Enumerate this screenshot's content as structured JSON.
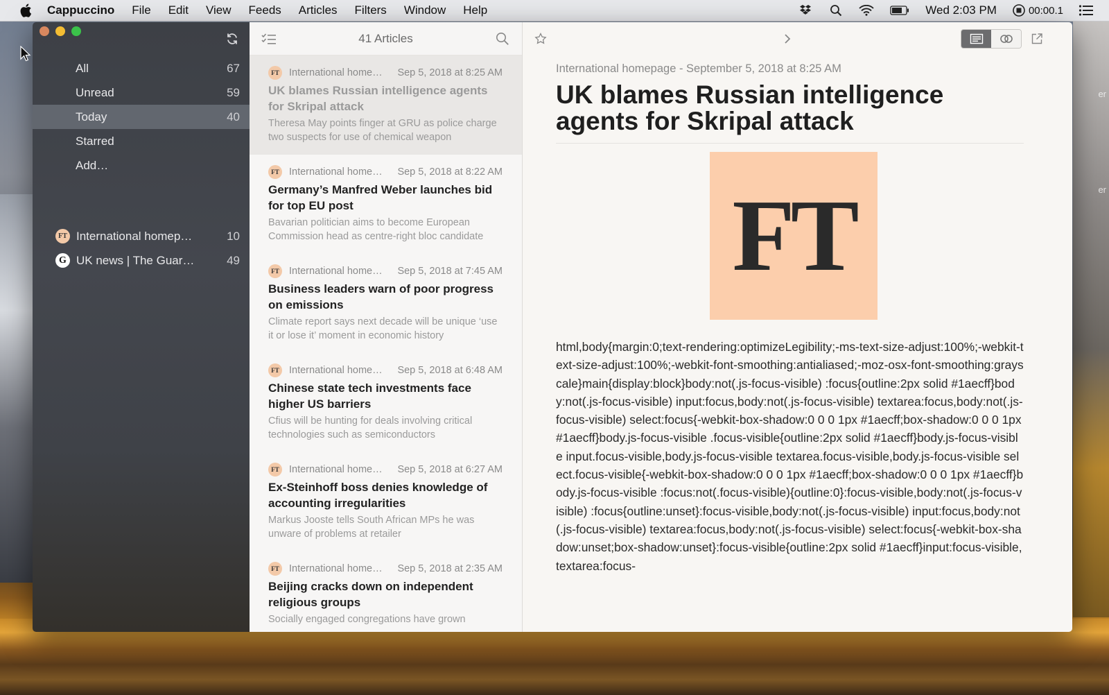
{
  "menubar": {
    "app_name": "Cappuccino",
    "menus": [
      "File",
      "Edit",
      "View",
      "Feeds",
      "Articles",
      "Filters",
      "Window",
      "Help"
    ],
    "clock": "Wed 2:03 PM",
    "timer": "00:00.1"
  },
  "desktop": {
    "label_top": "er",
    "label_bottom": "er"
  },
  "sidebar": {
    "smart_items": [
      {
        "label": "All",
        "count": "67"
      },
      {
        "label": "Unread",
        "count": "59"
      },
      {
        "label": "Today",
        "count": "40"
      },
      {
        "label": "Starred",
        "count": ""
      },
      {
        "label": "Add…",
        "count": ""
      }
    ],
    "feeds": [
      {
        "label": "International homep…",
        "count": "10",
        "favicon": "FT"
      },
      {
        "label": "UK news | The Guar…",
        "count": "49",
        "favicon": "G"
      }
    ]
  },
  "article_list": {
    "title": "41 Articles",
    "articles": [
      {
        "feed": "International home…",
        "date": "Sep 5, 2018 at 8:25 AM",
        "headline": "UK blames Russian intelligence agents for Skripal attack",
        "summary": "Theresa May points finger at GRU as police charge two suspects for use of chemical weapon"
      },
      {
        "feed": "International home…",
        "date": "Sep 5, 2018 at 8:22 AM",
        "headline": "Germany’s Manfred Weber launches bid for top EU post",
        "summary": "Bavarian politician aims to become European Commission head as centre-right bloc candidate"
      },
      {
        "feed": "International home…",
        "date": "Sep 5, 2018 at 7:45 AM",
        "headline": "Business leaders warn of poor progress on emissions",
        "summary": "Climate report says next decade will be unique ‘use it or lose it’ moment in economic history"
      },
      {
        "feed": "International home…",
        "date": "Sep 5, 2018 at 6:48 AM",
        "headline": "Chinese state tech investments face higher US barriers",
        "summary": "Cfius will be hunting for deals involving critical technologies such as semiconductors"
      },
      {
        "feed": "International home…",
        "date": "Sep 5, 2018 at 6:27 AM",
        "headline": "Ex-Steinhoff boss denies knowledge of accounting irregularities",
        "summary": "Markus Jooste tells South African MPs he was unware of problems at retailer"
      },
      {
        "feed": "International home…",
        "date": "Sep 5, 2018 at 2:35 AM",
        "headline": "Beijing cracks down on independent religious groups",
        "summary": "Socially engaged congregations have grown"
      }
    ],
    "favicon_text": "FT"
  },
  "reader": {
    "meta": "International homepage - September 5, 2018 at 8:25 AM",
    "title": "UK blames Russian intelligence agents for Skripal attack",
    "image_text": "FT",
    "body": "html,body{margin:0;text-rendering:optimizeLegibility;-ms-text-size-adjust:100%;-webkit-text-size-adjust:100%;-webkit-font-smoothing:antialiased;-moz-osx-font-smoothing:grayscale}main{display:block}body:not(.js-focus-visible) :focus{outline:2px solid #1aecff}body:not(.js-focus-visible) input:focus,body:not(.js-focus-visible) textarea:focus,body:not(.js-focus-visible) select:focus{-webkit-box-shadow:0 0 0 1px #1aecff;box-shadow:0 0 0 1px #1aecff}body.js-focus-visible .focus-visible{outline:2px solid #1aecff}body.js-focus-visible input.focus-visible,body.js-focus-visible textarea.focus-visible,body.js-focus-visible select.focus-visible{-webkit-box-shadow:0 0 0 1px #1aecff;box-shadow:0 0 0 1px #1aecff}body.js-focus-visible :focus:not(.focus-visible){outline:0}:focus-visible,body:not(.js-focus-visible) :focus{outline:unset}:focus-visible,body:not(.js-focus-visible) input:focus,body:not(.js-focus-visible) textarea:focus,body:not(.js-focus-visible) select:focus{-webkit-box-shadow:unset;box-shadow:unset}:focus-visible{outline:2px solid #1aecff}input:focus-visible,textarea:focus-"
  },
  "colors": {
    "sidebar_bg": "#3f4248",
    "sidebar_selected": "#62676f",
    "ft_pink": "#fcceac",
    "reader_bg": "#f8f6f3"
  }
}
